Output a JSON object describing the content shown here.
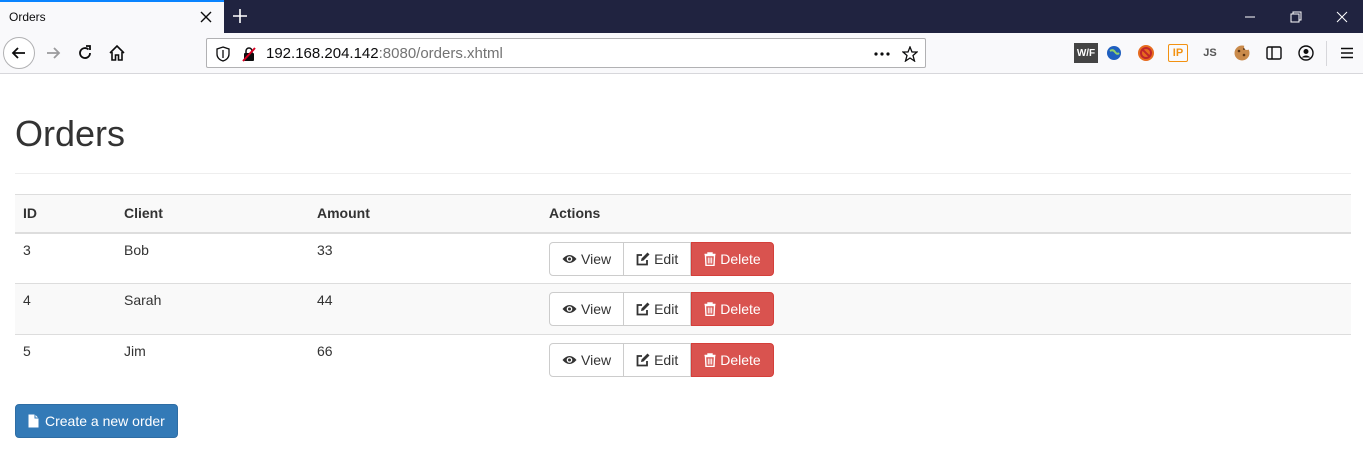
{
  "browser": {
    "tab_title": "Orders",
    "url_host": "192.168.204.142",
    "url_rest": ":8080/orders.xhtml",
    "extensions": [
      "W/F",
      "IP",
      "JS"
    ]
  },
  "page": {
    "title": "Orders",
    "table": {
      "headers": [
        "ID",
        "Client",
        "Amount",
        "Actions"
      ],
      "rows": [
        {
          "id": "3",
          "client": "Bob",
          "amount": "33"
        },
        {
          "id": "4",
          "client": "Sarah",
          "amount": "44"
        },
        {
          "id": "5",
          "client": "Jim",
          "amount": "66"
        }
      ]
    },
    "actions": {
      "view_label": "View",
      "edit_label": "Edit",
      "delete_label": "Delete"
    },
    "create_button_label": "Create a new order"
  },
  "colors": {
    "primary": "#337ab7",
    "danger": "#d9534f",
    "tabbar": "#202340",
    "tab_accent": "#0a84ff"
  }
}
